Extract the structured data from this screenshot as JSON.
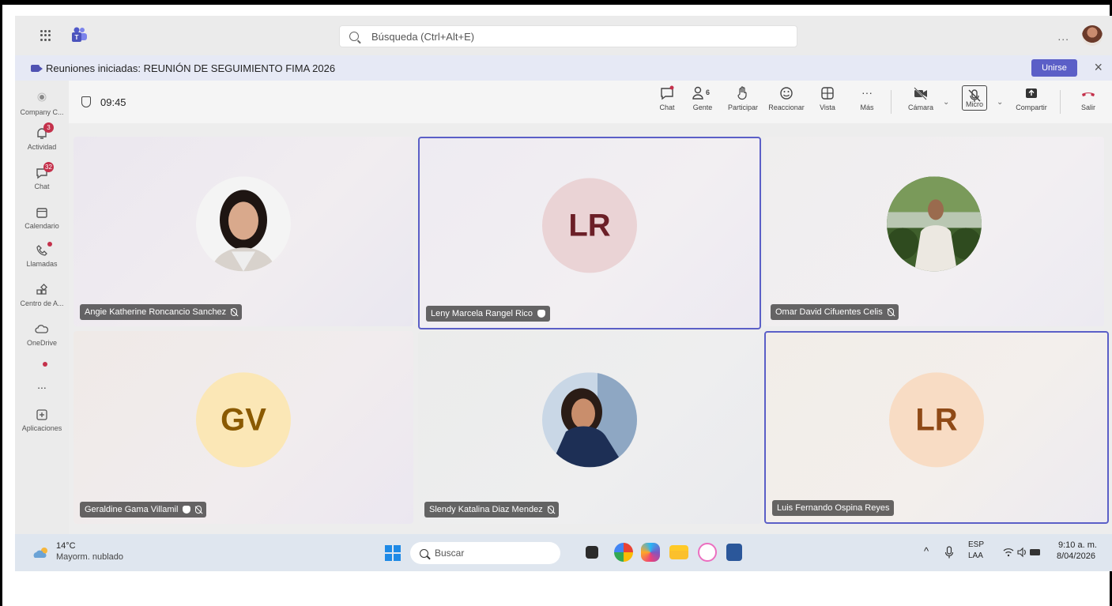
{
  "search": {
    "placeholder": "Búsqueda (Ctrl+Alt+E)"
  },
  "title_bar": {
    "more": "..."
  },
  "notification": {
    "text": "Reuniones iniciadas: REUNIÓN DE SEGUIMIENTO FIMA 2026",
    "join_label": "Unirse",
    "close": "×"
  },
  "rail": {
    "items": [
      {
        "label": "Company C...",
        "badge": ""
      },
      {
        "label": "Actividad",
        "badge": "3"
      },
      {
        "label": "Chat",
        "badge": "32"
      },
      {
        "label": "Calendario",
        "badge": ""
      },
      {
        "label": "Llamadas",
        "badge": ""
      },
      {
        "label": "Centro de A...",
        "badge": ""
      },
      {
        "label": "OneDrive",
        "badge": ""
      },
      {
        "label": "...",
        "badge": ""
      },
      {
        "label": "Aplicaciones",
        "badge": ""
      }
    ]
  },
  "meeting": {
    "timer": "09:45",
    "toolbar": {
      "chat": "Chat",
      "people": "Gente",
      "people_count": "6",
      "raise": "Participar",
      "react": "Reaccionar",
      "view": "Vista",
      "more": "Más",
      "camera": "Cámara",
      "mic": "Micro",
      "share": "Compartir",
      "leave": "Salir"
    }
  },
  "participants": [
    {
      "name": "Angie Katherine Roncancio Sanchez",
      "initials": "",
      "muted": true,
      "hand": false
    },
    {
      "name": "Leny Marcela Rangel Rico",
      "initials": "LR",
      "muted": false,
      "hand": true
    },
    {
      "name": "Omar David Cifuentes Celis",
      "initials": "",
      "muted": true,
      "hand": false
    },
    {
      "name": "Geraldine Gama Villamil",
      "initials": "GV",
      "muted": true,
      "hand": true
    },
    {
      "name": "Slendy Katalina Diaz Mendez",
      "initials": "",
      "muted": true,
      "hand": false
    },
    {
      "name": "Luis Fernando Ospina Reyes",
      "initials": "LR",
      "muted": false,
      "hand": false
    }
  ],
  "colors": {
    "accent": "#5b5fc7",
    "badge": "#c4314b",
    "leave": "#c4314b",
    "initials_lr_bg": "#ead3d5",
    "initials_lr_text": "#6b1f27",
    "initials_gv_bg": "#fbe7b6",
    "initials_gv_text": "#8a5a00",
    "initials_lr2_bg": "#f8dcc4",
    "initials_lr2_text": "#8f4a17"
  },
  "taskbar": {
    "weather_temp": "14°C",
    "weather_desc": "Mayorm. nublado",
    "search_label": "Buscar",
    "lang_1": "ESP",
    "lang_2": "LAA",
    "time": "9:10 a. m.",
    "date": "8/04/2026",
    "tray_up": "^"
  }
}
